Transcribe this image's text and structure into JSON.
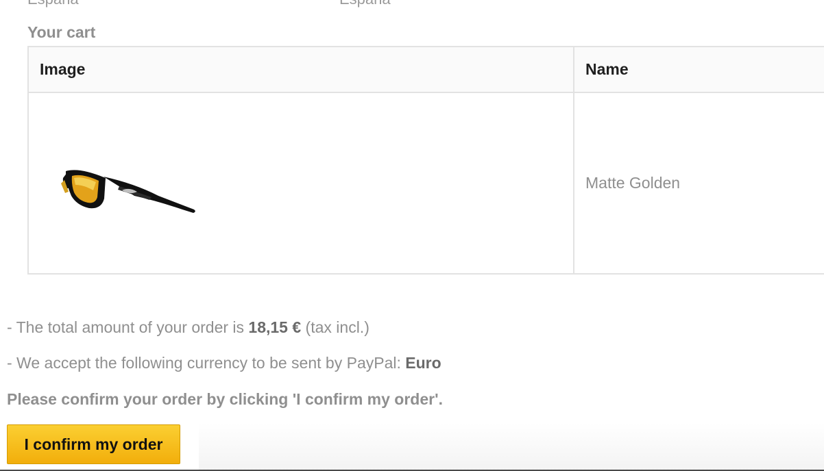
{
  "address": {
    "delivery_country": "España",
    "invoice_country": "España"
  },
  "cart": {
    "title": "Your cart",
    "columns": [
      "Image",
      "Name"
    ],
    "items": [
      {
        "name": "Matte Golden",
        "image": "sunglasses-image"
      }
    ]
  },
  "order": {
    "total_prefix": "- The total amount of your order is ",
    "total_amount": "18,15 €",
    "total_suffix": " (tax incl.)",
    "currency_prefix": "- We accept the following currency to be sent by PayPal: ",
    "currency": "Euro",
    "confirm_message": "Please confirm your order by clicking 'I confirm my order'.",
    "confirm_button_label": "I confirm my order"
  },
  "colors": {
    "button": "#f7bf1f",
    "muted_text": "#8f8f8f",
    "border": "#e2e2e2"
  }
}
